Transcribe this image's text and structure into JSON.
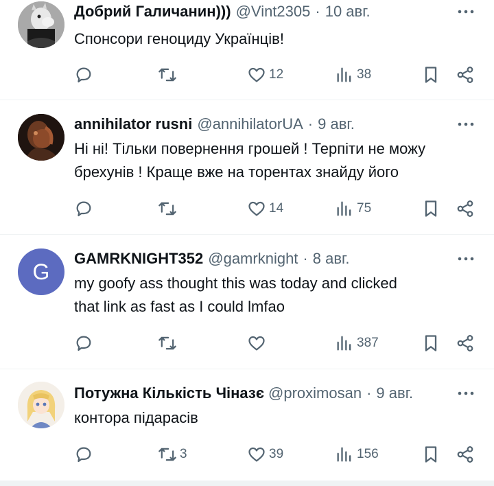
{
  "tweets": [
    {
      "name": "Добрий Галичанин)))",
      "handle": "@Vint2305",
      "dot": "·",
      "date": "10 авг.",
      "lines": [
        "Спонсори геноциду Українців!"
      ],
      "replies": "",
      "retweets": "",
      "likes": "12",
      "views": "38",
      "avatar_icon": "moomin-avatar"
    },
    {
      "name": "annihilator rusni",
      "handle": "@annihilatorUA",
      "dot": "·",
      "date": "9 авг.",
      "lines": [
        "Ні ні! Тільки повернення грошей ! Терпіти не можу",
        "брехунів ! Краще вже на торентах знайду його"
      ],
      "replies": "",
      "retweets": "",
      "likes": "14",
      "views": "75",
      "avatar_icon": "dark-figure-avatar"
    },
    {
      "name": "GAMRKNIGHT352",
      "handle": "@gamrknight",
      "dot": "·",
      "date": "8 авг.",
      "lines": [
        "my goofy ass thought this was today and clicked",
        "that link as fast as I could lmfao"
      ],
      "replies": "",
      "retweets": "",
      "likes": "",
      "views": "387",
      "avatar_letter": "G",
      "avatar_color": "#5c6bc0"
    },
    {
      "name": "Потужна Кількість Чіназє",
      "handle": "@proximosan",
      "dot": "·",
      "date": "9 авг.",
      "lines": [
        "контора підарасів"
      ],
      "replies": "",
      "retweets": "3",
      "likes": "39",
      "views": "156",
      "avatar_icon": "anime-girl-avatar"
    }
  ],
  "colors": {
    "text": "#0f1419",
    "secondary": "#536471",
    "divider": "#eff3f4"
  }
}
